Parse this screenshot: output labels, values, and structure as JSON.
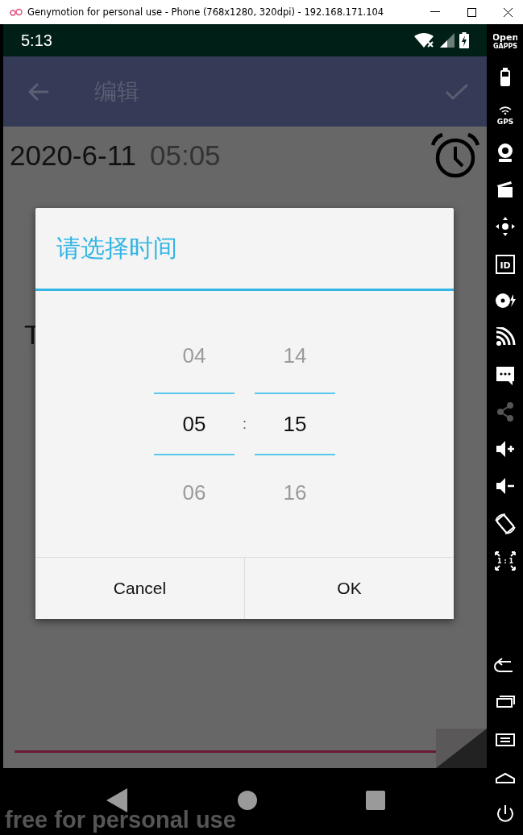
{
  "window": {
    "title": "Genymotion for personal use - Phone (768x1280, 320dpi) - 192.168.171.104"
  },
  "status_bar": {
    "time": "5:13"
  },
  "toolbar": {
    "title": "编辑"
  },
  "content": {
    "date": "2020-6-11",
    "time": "05:05",
    "note_text": "T"
  },
  "dialog": {
    "title": "请选择时间",
    "hours": [
      {
        "label": "04",
        "selected": false
      },
      {
        "label": "05",
        "selected": true
      },
      {
        "label": "06",
        "selected": false
      }
    ],
    "separator": ":",
    "minutes": [
      {
        "label": "14",
        "selected": false
      },
      {
        "label": "15",
        "selected": true
      },
      {
        "label": "16",
        "selected": false
      }
    ],
    "buttons": [
      "Cancel",
      "OK"
    ]
  },
  "overlay_text": "free for personal use",
  "sidebar": {
    "items": [
      {
        "kind": "gapps",
        "label_top": "Open",
        "label_bottom": "GAPPS",
        "disabled": false
      },
      {
        "kind": "battery",
        "disabled": false
      },
      {
        "kind": "gps",
        "label": "GPS",
        "disabled": false
      },
      {
        "kind": "camera",
        "disabled": false
      },
      {
        "kind": "clapper",
        "disabled": false
      },
      {
        "kind": "dpad",
        "disabled": false
      },
      {
        "kind": "id",
        "label": "ID",
        "disabled": false
      },
      {
        "kind": "disk",
        "disabled": false
      },
      {
        "kind": "rss",
        "disabled": false
      },
      {
        "kind": "message",
        "disabled": false
      },
      {
        "kind": "share",
        "disabled": true
      },
      {
        "kind": "volup",
        "disabled": false
      },
      {
        "kind": "voldown",
        "disabled": false
      },
      {
        "kind": "rotate",
        "disabled": false
      },
      {
        "kind": "scale",
        "label": "1 : 1",
        "disabled": false
      }
    ],
    "bottom_items": [
      {
        "kind": "back"
      },
      {
        "kind": "recent"
      },
      {
        "kind": "menu"
      },
      {
        "kind": "home"
      },
      {
        "kind": "power"
      }
    ]
  }
}
